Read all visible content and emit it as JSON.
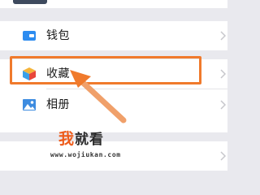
{
  "menu": {
    "wallet": {
      "label": "钱包",
      "icon": "wallet-card-icon"
    },
    "favorites": {
      "label": "收藏",
      "icon": "cube-icon"
    },
    "album": {
      "label": "相册",
      "icon": "photo-icon"
    }
  },
  "annotation": {
    "highlight_color": "#f07a2c",
    "arrow_color": "#f0a06a"
  },
  "watermark": {
    "brand_accent": "我",
    "brand_rest": "就看",
    "url": "www.wojiukan.com",
    "accent_color": "#ee5b1a"
  }
}
